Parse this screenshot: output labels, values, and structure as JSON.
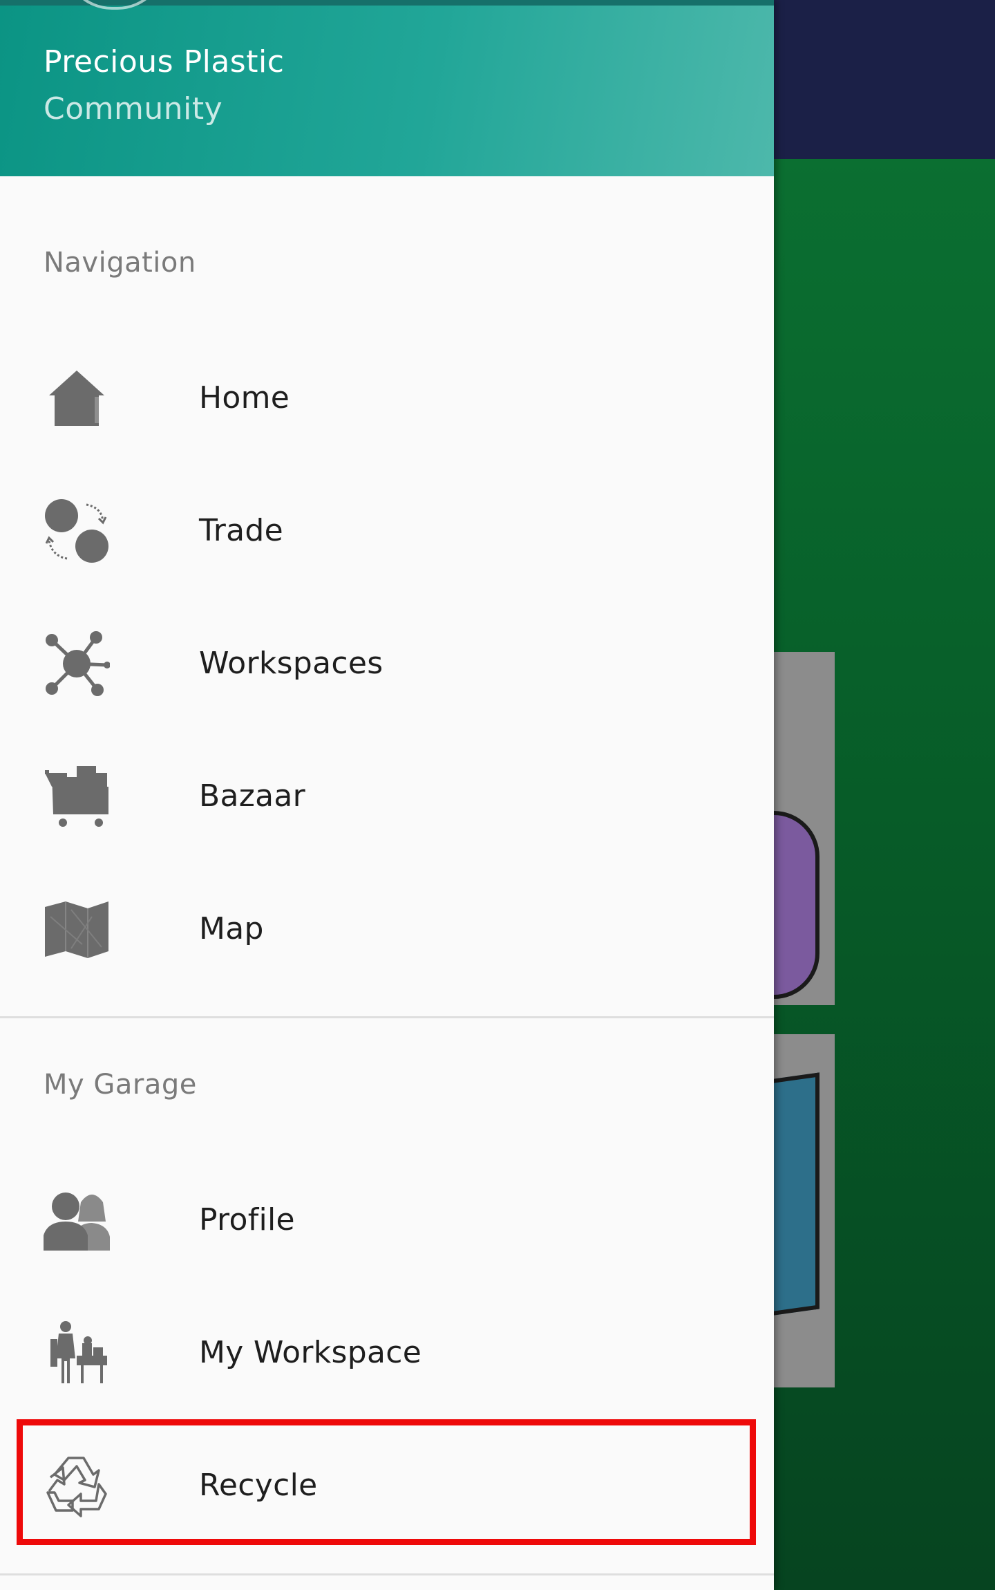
{
  "header": {
    "title": "Precious Plastic",
    "subtitle": "Community"
  },
  "sections": {
    "navigation_label": "Navigation",
    "garage_label": "My Garage"
  },
  "navigation": {
    "items": [
      {
        "label": "Home",
        "icon": "home-icon"
      },
      {
        "label": "Trade",
        "icon": "trade-icon"
      },
      {
        "label": "Workspaces",
        "icon": "workspaces-icon"
      },
      {
        "label": "Bazaar",
        "icon": "bazaar-cart-icon"
      },
      {
        "label": "Map",
        "icon": "map-icon"
      }
    ]
  },
  "garage": {
    "items": [
      {
        "label": "Profile",
        "icon": "profile-icon"
      },
      {
        "label": "My Workspace",
        "icon": "my-workspace-icon"
      },
      {
        "label": "Recycle",
        "icon": "recycle-icon",
        "highlighted": true
      }
    ]
  },
  "colors": {
    "header_gradient_start": "#0b9484",
    "header_gradient_end": "#4db8ab",
    "drawer_bg": "#fafafa",
    "icon_gray": "#6b6b6b",
    "highlight_red": "#ee0a0a",
    "app_bar_navy": "#1b2047",
    "content_green": "#0b6f31"
  }
}
